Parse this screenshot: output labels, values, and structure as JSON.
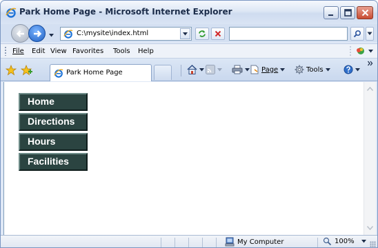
{
  "window": {
    "title": "Park Home Page - Microsoft Internet Explorer",
    "controls": {
      "minimize": "minimize-icon",
      "maximize": "maximize-icon",
      "close": "close-icon"
    }
  },
  "address_bar": {
    "url": "C:\\mysite\\index.html",
    "search_placeholder": ""
  },
  "menu": {
    "file": "File",
    "edit": "Edit",
    "view": "View",
    "favorites": "Favorites",
    "tools": "Tools",
    "help": "Help"
  },
  "tabs": [
    {
      "label": "Park Home Page",
      "active": true
    }
  ],
  "command_bar": {
    "page": "Page",
    "tools": "Tools"
  },
  "page": {
    "nav_items": [
      "Home",
      "Directions",
      "Hours",
      "Facilities"
    ]
  },
  "status_bar": {
    "zone": "My Computer",
    "zoom": "100%"
  },
  "colors": {
    "nav_button_bg": "#2b4441",
    "nav_button_text": "#ffffff",
    "chrome_blue": "#d4e0f2"
  }
}
